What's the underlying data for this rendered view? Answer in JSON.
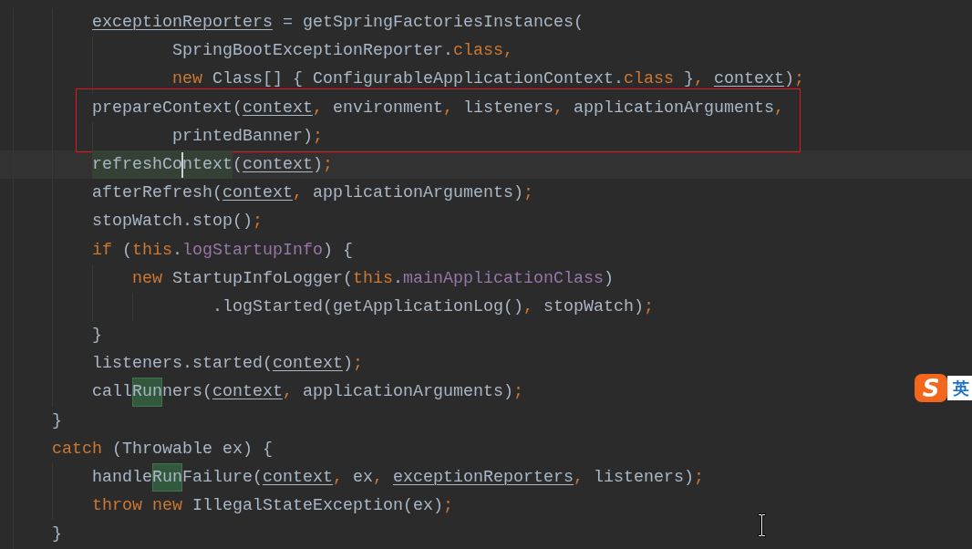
{
  "editor": {
    "lines": [
      {
        "kind": "block",
        "children": [
          {
            "kind": "wrap",
            "current": false,
            "boxed": false,
            "tokens": [
              {
                "kind": "local",
                "text": "exceptionReporters"
              },
              {
                "kind": "plain",
                "text": " = getSpringFactoriesInstances("
              }
            ],
            "children": [
              {
                "current": false,
                "boxed": false,
                "tokens": [
                  {
                    "kind": "plain",
                    "text": "SpringBootExceptionReporter."
                  },
                  {
                    "kind": "keyword",
                    "text": "class,"
                  }
                ]
              },
              {
                "current": false,
                "boxed": false,
                "tokens": [
                  {
                    "kind": "keyword",
                    "text": "new"
                  },
                  {
                    "kind": "plain",
                    "text": " Class[] { ConfigurableApplicationContext."
                  },
                  {
                    "kind": "keyword",
                    "text": "class"
                  },
                  {
                    "kind": "plain",
                    "text": " }"
                  },
                  {
                    "kind": "keyword",
                    "text": ", "
                  },
                  {
                    "kind": "local",
                    "text": "context"
                  },
                  {
                    "kind": "plain",
                    "text": ")"
                  },
                  {
                    "kind": "keyword",
                    "text": ";"
                  }
                ]
              }
            ]
          },
          {
            "kind": "wrap",
            "current": false,
            "boxed": true,
            "tokens": [
              {
                "kind": "plain",
                "text": "prepareContext("
              },
              {
                "kind": "local",
                "text": "context"
              },
              {
                "kind": "keyword",
                "text": ", "
              },
              {
                "kind": "plain",
                "text": "environment"
              },
              {
                "kind": "keyword",
                "text": ", "
              },
              {
                "kind": "plain",
                "text": "listeners"
              },
              {
                "kind": "keyword",
                "text": ", "
              },
              {
                "kind": "plain",
                "text": "applicationArguments"
              },
              {
                "kind": "keyword",
                "text": ","
              }
            ],
            "children": [
              {
                "current": false,
                "boxed": false,
                "tokens": [
                  {
                    "kind": "plain",
                    "text": "printedBanner)"
                  },
                  {
                    "kind": "keyword",
                    "text": ";"
                  }
                ]
              }
            ]
          },
          {
            "current": true,
            "boxed": false,
            "tokens": [
              {
                "kind": "usage",
                "text": "refreshCo"
              },
              {
                "kind": "caret"
              },
              {
                "kind": "usage",
                "text": "ntext"
              },
              {
                "kind": "plain",
                "text": "("
              },
              {
                "kind": "local",
                "text": "context"
              },
              {
                "kind": "plain",
                "text": ")"
              },
              {
                "kind": "keyword",
                "text": ";"
              }
            ]
          },
          {
            "current": false,
            "boxed": false,
            "tokens": [
              {
                "kind": "plain",
                "text": "afterRefresh("
              },
              {
                "kind": "local",
                "text": "context"
              },
              {
                "kind": "keyword",
                "text": ", "
              },
              {
                "kind": "plain",
                "text": "applicationArguments)"
              },
              {
                "kind": "keyword",
                "text": ";"
              }
            ]
          },
          {
            "current": false,
            "boxed": false,
            "tokens": [
              {
                "kind": "plain",
                "text": "stopWatch.stop()"
              },
              {
                "kind": "keyword",
                "text": ";"
              }
            ]
          },
          {
            "kind": "block",
            "current": false,
            "boxed": false,
            "tokens": [
              {
                "kind": "keyword",
                "text": "if"
              },
              {
                "kind": "plain",
                "text": " ("
              },
              {
                "kind": "keyword",
                "text": "this"
              },
              {
                "kind": "plain",
                "text": "."
              },
              {
                "kind": "field",
                "text": "logStartupInfo"
              },
              {
                "kind": "plain",
                "text": ") {"
              }
            ],
            "children": [
              {
                "kind": "wrap",
                "current": false,
                "boxed": false,
                "tokens": [
                  {
                    "kind": "keyword",
                    "text": "new"
                  },
                  {
                    "kind": "plain",
                    "text": " StartupInfoLogger("
                  },
                  {
                    "kind": "keyword",
                    "text": "this"
                  },
                  {
                    "kind": "plain",
                    "text": "."
                  },
                  {
                    "kind": "field",
                    "text": "mainApplicationClass"
                  },
                  {
                    "kind": "plain",
                    "text": ")"
                  }
                ],
                "children": [
                  {
                    "current": false,
                    "boxed": false,
                    "tokens": [
                      {
                        "kind": "plain",
                        "text": ".logStarted(getApplicationLog()"
                      },
                      {
                        "kind": "keyword",
                        "text": ", "
                      },
                      {
                        "kind": "plain",
                        "text": "stopWatch)"
                      },
                      {
                        "kind": "keyword",
                        "text": ";"
                      }
                    ]
                  }
                ]
              }
            ]
          },
          {
            "current": false,
            "boxed": false,
            "tokens": [
              {
                "kind": "plain",
                "text": "}"
              }
            ]
          },
          {
            "current": false,
            "boxed": false,
            "tokens": [
              {
                "kind": "plain",
                "text": "listeners.started("
              },
              {
                "kind": "local",
                "text": "context"
              },
              {
                "kind": "plain",
                "text": ")"
              },
              {
                "kind": "keyword",
                "text": ";"
              }
            ]
          },
          {
            "current": false,
            "boxed": false,
            "tokens": [
              {
                "kind": "plain",
                "text": "call"
              },
              {
                "kind": "match",
                "text": "Run"
              },
              {
                "kind": "plain",
                "text": "ners("
              },
              {
                "kind": "local",
                "text": "context"
              },
              {
                "kind": "keyword",
                "text": ", "
              },
              {
                "kind": "plain",
                "text": "applicationArguments)"
              },
              {
                "kind": "keyword",
                "text": ";"
              }
            ]
          }
        ]
      },
      {
        "current": false,
        "boxed": false,
        "tokens": [
          {
            "kind": "plain",
            "text": "}"
          }
        ]
      },
      {
        "kind": "block",
        "current": false,
        "boxed": false,
        "tokens": [
          {
            "kind": "keyword",
            "text": "catch"
          },
          {
            "kind": "plain",
            "text": " (Throwable ex) {"
          }
        ],
        "children": [
          {
            "current": false,
            "boxed": false,
            "tokens": [
              {
                "kind": "plain",
                "text": "handle"
              },
              {
                "kind": "match",
                "text": "Run"
              },
              {
                "kind": "plain",
                "text": "Failure("
              },
              {
                "kind": "local",
                "text": "context"
              },
              {
                "kind": "keyword",
                "text": ", "
              },
              {
                "kind": "plain",
                "text": "ex"
              },
              {
                "kind": "keyword",
                "text": ", "
              },
              {
                "kind": "local",
                "text": "exceptionReporters"
              },
              {
                "kind": "keyword",
                "text": ", "
              },
              {
                "kind": "plain",
                "text": "listeners)"
              },
              {
                "kind": "keyword",
                "text": ";"
              }
            ]
          },
          {
            "current": false,
            "boxed": false,
            "tokens": [
              {
                "kind": "keyword",
                "text": "throw new"
              },
              {
                "kind": "plain",
                "text": " IllegalStateException(ex)"
              },
              {
                "kind": "keyword",
                "text": ";"
              }
            ]
          }
        ]
      },
      {
        "current": false,
        "boxed": false,
        "tokens": [
          {
            "kind": "plain",
            "text": "}"
          }
        ]
      }
    ]
  },
  "ime": {
    "logo": "S",
    "mode": "英"
  }
}
